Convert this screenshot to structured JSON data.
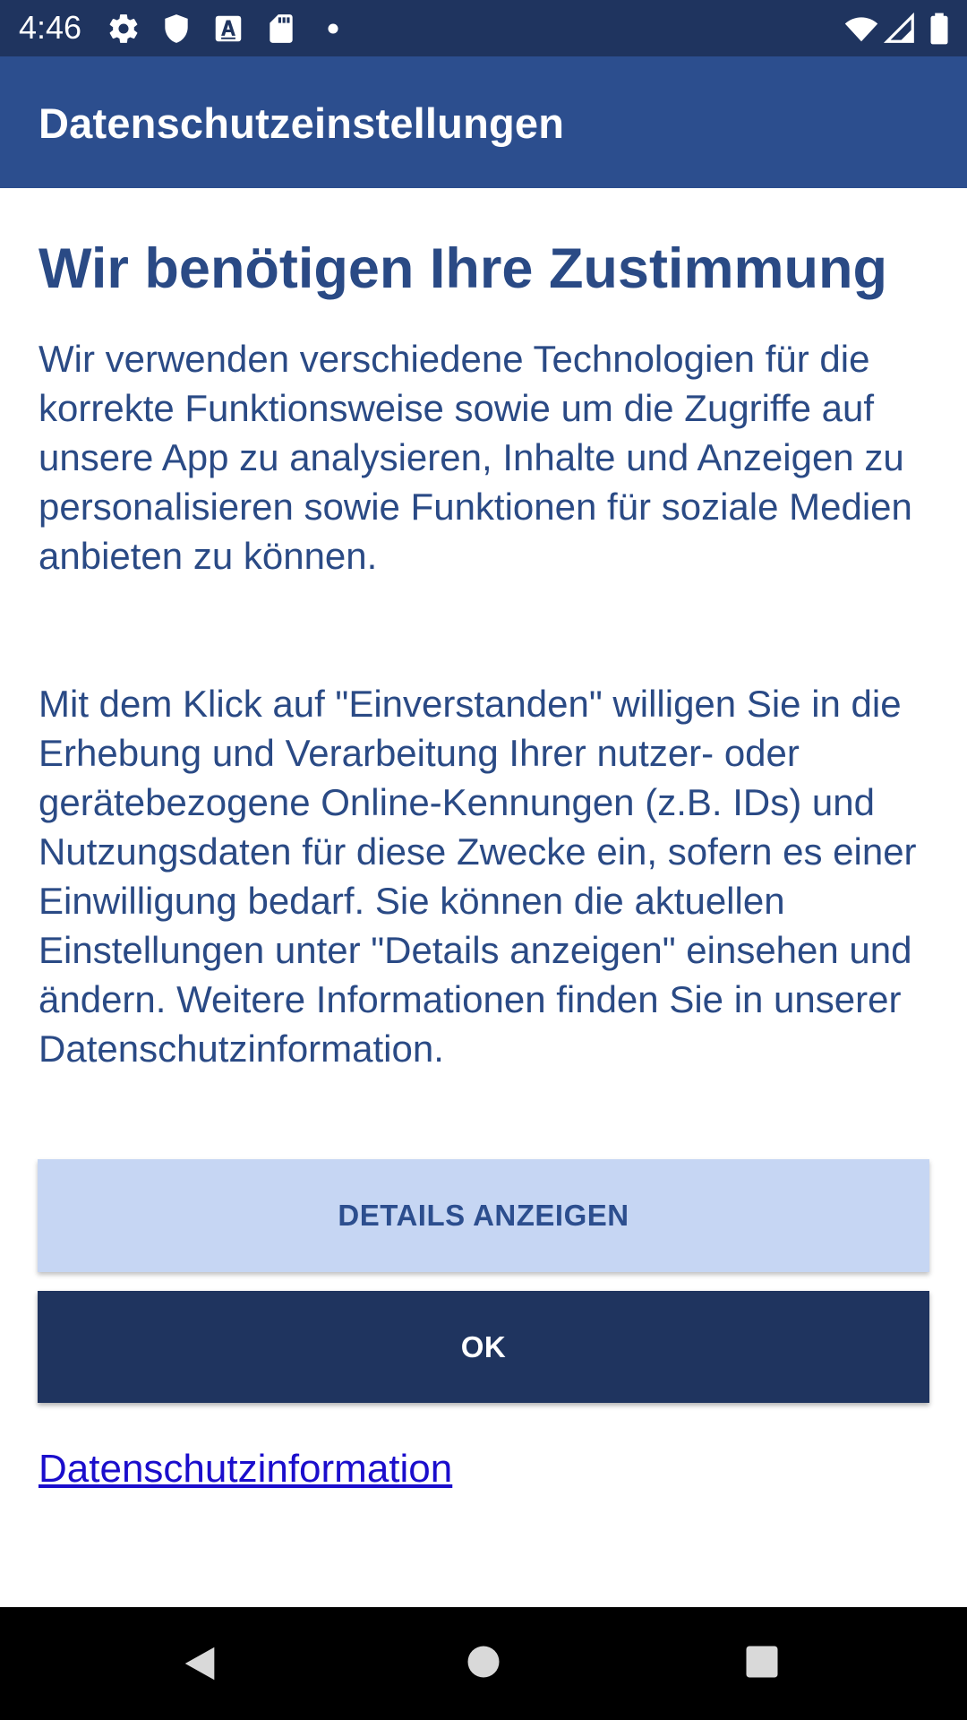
{
  "status_bar": {
    "time": "4:46",
    "left_icons": [
      "gear-icon",
      "shield-icon",
      "a-box-icon",
      "sd-card-icon",
      "dot-icon"
    ],
    "right_icons": [
      "wifi-icon",
      "signal-icon",
      "battery-icon"
    ]
  },
  "app_bar": {
    "title": "Datenschutzeinstellungen"
  },
  "main": {
    "headline": "Wir benötigen Ihre Zustimmung",
    "paragraph1": "Wir verwenden verschiedene Technologien für die korrekte Funktionsweise sowie um die Zugriffe auf unsere App zu analysieren, Inhalte und Anzeigen zu personalisieren sowie Funktionen für soziale Medien anbieten zu können.",
    "paragraph2": "Mit dem Klick auf \"Einverstanden\" willigen Sie in die Erhebung und Verarbeitung Ihrer nutzer- oder gerätebezogene Online-Kennungen (z.B. IDs) und Nutzungsdaten für diese Zwecke ein, sofern es einer Einwilligung bedarf. Sie können die aktuellen Einstellungen unter \"Details anzeigen\" einsehen und ändern. Weitere Informationen finden Sie in unserer Datenschutzinformation.",
    "details_button": "DETAILS ANZEIGEN",
    "ok_button": "OK",
    "privacy_link": "Datenschutzinformation"
  },
  "colors": {
    "status_bar": "#1f345f",
    "app_bar": "#2c4e8e",
    "text": "#2a4a85",
    "details_bg": "#c6d6f3",
    "ok_bg": "#1f345f",
    "link": "#1a0dcc"
  },
  "nav_bar": {
    "icons": [
      "back-icon",
      "home-icon",
      "recents-icon"
    ]
  }
}
